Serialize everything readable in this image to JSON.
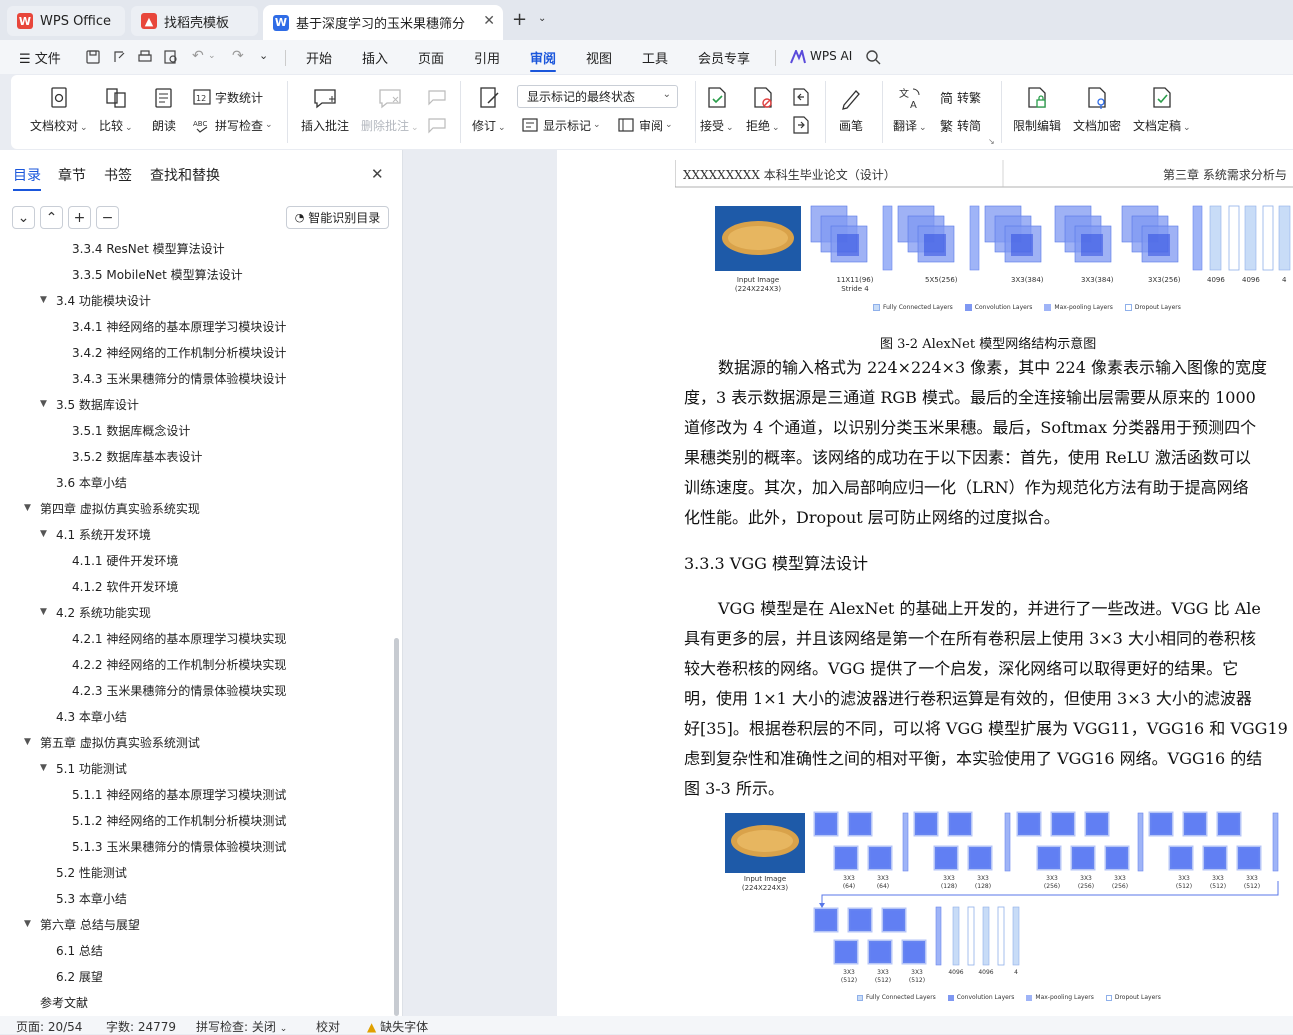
{
  "tabs": [
    {
      "label": "WPS Office",
      "icon": "wps-logo-icon"
    },
    {
      "label": "找稻壳模板",
      "icon": "docer-icon"
    },
    {
      "label": "基于深度学习的玉米果穗筛分",
      "icon": "writer-doc-icon"
    }
  ],
  "menu": {
    "file": "文件",
    "items": [
      "开始",
      "插入",
      "页面",
      "引用",
      "审阅",
      "视图",
      "工具",
      "会员专享"
    ],
    "active": "审阅",
    "ai": "WPS AI"
  },
  "ribbon": {
    "doc_check": "文档校对",
    "compare": "比较",
    "read_aloud": "朗读",
    "word_count": "字数统计",
    "spell_check": "拼写检查",
    "insert_comment": "插入批注",
    "delete_comment": "删除批注",
    "revise": "修订",
    "markup_state": "显示标记的最终状态",
    "show_markup": "显示标记",
    "review_pane": "审阅",
    "accept": "接受",
    "reject": "拒绝",
    "pen": "画笔",
    "translate": "翻译",
    "to_traditional": "转繁",
    "to_simplified": "转简",
    "restrict_edit": "限制编辑",
    "encrypt": "文档加密",
    "finalize": "文档定稿"
  },
  "panel": {
    "tabs": [
      "目录",
      "章节",
      "书签",
      "查找和替换"
    ],
    "smart_toc": "智能识别目录",
    "toc": [
      {
        "text": "3.3.4 ResNet 模型算法设计",
        "level": 3
      },
      {
        "text": "3.3.5 MobileNet 模型算法设计",
        "level": 3
      },
      {
        "text": "3.4 功能模块设计",
        "level": 2,
        "expanded": true
      },
      {
        "text": "3.4.1 神经网络的基本原理学习模块设计",
        "level": 3
      },
      {
        "text": "3.4.2 神经网络的工作机制分析模块设计",
        "level": 3
      },
      {
        "text": "3.4.3 玉米果穗筛分的情景体验模块设计",
        "level": 3
      },
      {
        "text": "3.5 数据库设计",
        "level": 2,
        "expanded": true
      },
      {
        "text": "3.5.1 数据库概念设计",
        "level": 3
      },
      {
        "text": "3.5.2 数据库基本表设计",
        "level": 3
      },
      {
        "text": "3.6 本章小结",
        "level": 2
      },
      {
        "text": "第四章  虚拟仿真实验系统实现",
        "level": 1,
        "expanded": true
      },
      {
        "text": "4.1 系统开发环境",
        "level": 2,
        "expanded": true
      },
      {
        "text": "4.1.1 硬件开发环境",
        "level": 3
      },
      {
        "text": "4.1.2 软件开发环境",
        "level": 3
      },
      {
        "text": "4.2 系统功能实现",
        "level": 2,
        "expanded": true
      },
      {
        "text": "4.2.1 神经网络的基本原理学习模块实现",
        "level": 3
      },
      {
        "text": "4.2.2 神经网络的工作机制分析模块实现",
        "level": 3
      },
      {
        "text": "4.2.3 玉米果穗筛分的情景体验模块实现",
        "level": 3
      },
      {
        "text": "4.3 本章小结",
        "level": 2
      },
      {
        "text": "第五章  虚拟仿真实验系统测试",
        "level": 1,
        "expanded": true
      },
      {
        "text": "5.1 功能测试",
        "level": 2,
        "expanded": true
      },
      {
        "text": "5.1.1 神经网络的基本原理学习模块测试",
        "level": 3
      },
      {
        "text": "5.1.2 神经网络的工作机制分析模块测试",
        "level": 3
      },
      {
        "text": "5.1.3 玉米果穗筛分的情景体验模块测试",
        "level": 3
      },
      {
        "text": "5.2 性能测试",
        "level": 2
      },
      {
        "text": "5.3 本章小结",
        "level": 2
      },
      {
        "text": "第六章  总结与展望",
        "level": 1,
        "expanded": true
      },
      {
        "text": "6.1 总结",
        "level": 2
      },
      {
        "text": "6.2 展望",
        "level": 2
      },
      {
        "text": "参考文献",
        "level": 1
      }
    ]
  },
  "doc": {
    "header_left": "XXXXXXXXX 本科生毕业论文（设计）",
    "header_right": "第三章  系统需求分析与",
    "fig1": {
      "caption": "图  3-2  AlexNet 模型网络结构示意图",
      "input_label": "Input Image",
      "input_size": "(224X224X3)",
      "layer_labels": [
        "11X11(96)",
        "Stride 4",
        "5X5(256)",
        "3X3(384)",
        "3X3(384)",
        "3X3(256)",
        "4096",
        "4096",
        "4"
      ],
      "legend": [
        "Fully Connected Layers",
        "Convolution Layers",
        "Max-pooling Layers",
        "Dropout Layers"
      ]
    },
    "para1": [
      "数据源的输入格式为 224×224×3 像素，其中 224 像素表示输入图像的宽度",
      "度，3 表示数据源是三通道 RGB 模式。最后的全连接输出层需要从原来的 1000",
      "道修改为 4 个通道，以识别分类玉米果穗。最后，Softmax 分类器用于预测四个",
      "果穗类别的概率。该网络的成功在于以下因素：首先，使用 ReLU 激活函数可以",
      "训练速度。其次，加入局部响应归一化（LRN）作为规范化方法有助于提高网络",
      "化性能。此外，Dropout 层可防止网络的过度拟合。"
    ],
    "subheading": "3.3.3 VGG 模型算法设计",
    "para2": [
      "VGG 模型是在 AlexNet 的基础上开发的，并进行了一些改进。VGG 比 Ale",
      "具有更多的层，并且该网络是第一个在所有卷积层上使用 3×3 大小相同的卷积核",
      "较大卷积核的网络。VGG 提供了一个启发，深化网络可以取得更好的结果。它",
      "明，使用 1×1 大小的滤波器进行卷积运算是有效的，但使用 3×3 大小的滤波器",
      "好[35]。根据卷积层的不同，可以将 VGG 模型扩展为 VGG11，VGG16 和 VGG19",
      "虑到复杂性和准确性之间的相对平衡，本实验使用了 VGG16 网络。VGG16 的结",
      "图 3-3 所示。"
    ],
    "fig2": {
      "input_label": "Input Image",
      "input_size": "(224X224X3)",
      "row1_labels": [
        "3X3",
        "(64)",
        "3X3",
        "(64)",
        "3X3",
        "(128)",
        "3X3",
        "(128)",
        "3X3",
        "(256)",
        "3X3",
        "(256)",
        "3X3",
        "(256)",
        "3X3",
        "(512)",
        "3X3",
        "(512)",
        "3X3",
        "(512)"
      ],
      "row2_labels": [
        "3X3",
        "(512)",
        "3X3",
        "(512)",
        "3X3",
        "(512)",
        "4096",
        "4096",
        "4"
      ],
      "legend": [
        "Fully Connected Layers",
        "Convolution Layers",
        "Max-pooling Layers",
        "Dropout Layers"
      ]
    }
  },
  "status": {
    "page": "页面: 20/54",
    "words": "字数: 24779",
    "spell": "拼写检查: 关闭",
    "proof": "校对",
    "missing_font": "缺失字体"
  },
  "colors": {
    "accent": "#1a56db",
    "conv": "#6e8cf0",
    "pool": "#8aa4f5",
    "fc": "#bcd4f7"
  }
}
